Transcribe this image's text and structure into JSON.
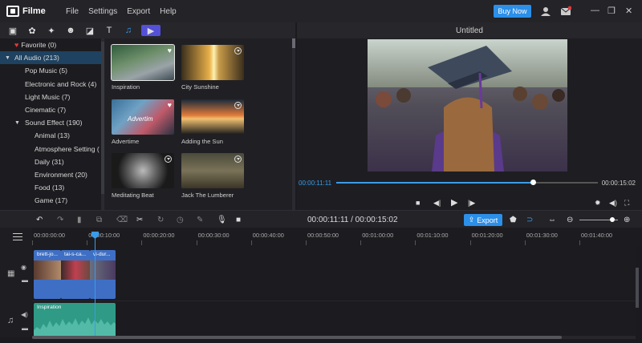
{
  "app": {
    "name": "Filme",
    "buy_label": "Buy Now"
  },
  "menu": [
    "File",
    "Settings",
    "Export",
    "Help"
  ],
  "sidebar": {
    "favorite": "Favorite (0)",
    "items": [
      {
        "label": "All Audio (213)",
        "level": 0,
        "expanded": true,
        "selected": true
      },
      {
        "label": "Pop Music (5)",
        "level": 1
      },
      {
        "label": "Electronic and Rock (4)",
        "level": 1
      },
      {
        "label": "Light Music (7)",
        "level": 1
      },
      {
        "label": "Cinematic (7)",
        "level": 1
      },
      {
        "label": "Sound Effect (190)",
        "level": 1,
        "expanded": true
      },
      {
        "label": "Animal (13)",
        "level": 2
      },
      {
        "label": "Atmosphere Setting (",
        "level": 2
      },
      {
        "label": "Daily (31)",
        "level": 2
      },
      {
        "label": "Environment (20)",
        "level": 2
      },
      {
        "label": "Food (13)",
        "level": 2
      },
      {
        "label": "Game (17)",
        "level": 2
      }
    ]
  },
  "media": [
    {
      "label": "Inspiration",
      "icon": "heart-icon",
      "selected": true
    },
    {
      "label": "City Sunshine",
      "icon": "download-icon"
    },
    {
      "label": "Advertime",
      "icon": "heart-icon",
      "overlay": "Advertim"
    },
    {
      "label": "Adding the Sun",
      "icon": "download-icon"
    },
    {
      "label": "Meditating Beat",
      "icon": "download-icon"
    },
    {
      "label": "Jack The Lumberer",
      "icon": "download-icon"
    }
  ],
  "preview": {
    "title": "Untitled",
    "current_time": "00:00:11:11",
    "total_time": "00:00:15:02",
    "progress": 0.75
  },
  "timeline": {
    "time_display": "00:00:11:11 / 00:00:15:02",
    "export_label": "Export",
    "zoom": 0.86,
    "ruler": [
      "00:00:00:00",
      "00:00:10:00",
      "00:00:20:00",
      "00:00:30:00",
      "00:00:40:00",
      "00:00:50:00",
      "00:01:00:00",
      "00:01:10:00",
      "00:01:20:00",
      "00:01:30:00",
      "00:01:40:00"
    ],
    "video_clips": [
      "brett-jo...",
      "tai-s-ca...",
      "vi-dur..."
    ],
    "audio_clip": "Inspiration"
  },
  "colors": {
    "accent": "#2c8fe8",
    "video_clip": "#3f6fc4",
    "audio_clip": "#2f9a86",
    "selected_row": "#1e4260"
  }
}
